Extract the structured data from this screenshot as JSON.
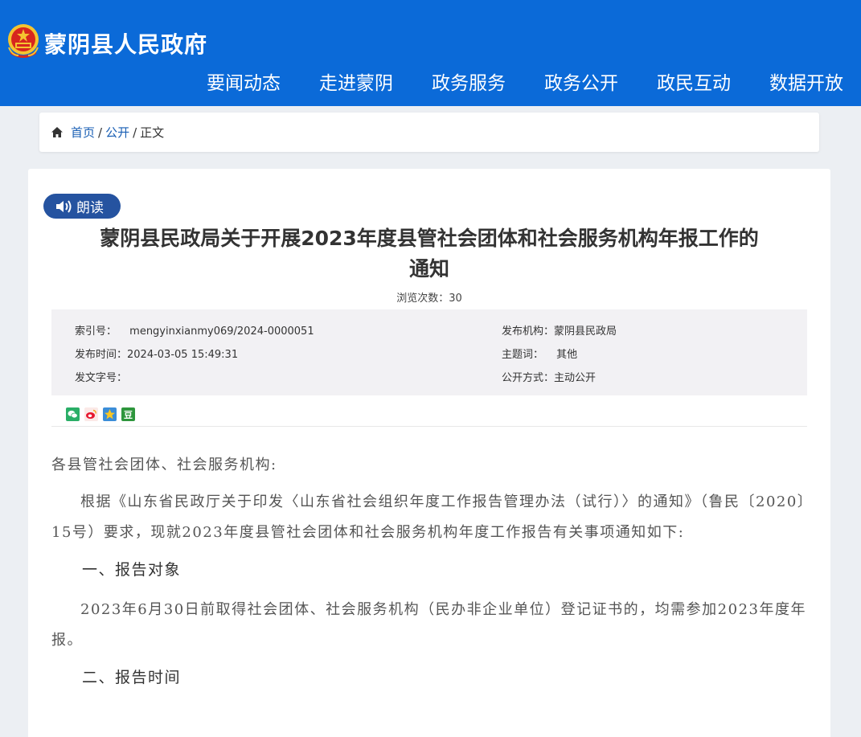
{
  "site": {
    "title": "蒙阴县人民政府"
  },
  "nav": [
    "要闻动态",
    "走进蒙阴",
    "政务服务",
    "政务公开",
    "政民互动",
    "数据开放"
  ],
  "breadcrumb": {
    "home": "首页",
    "section": "公开",
    "current": "正文",
    "sep": "/"
  },
  "read_aloud": "朗读",
  "document": {
    "title": "蒙阴县民政局关于开展2023年度县管社会团体和社会服务机构年报工作的通知",
    "title_line1": "蒙阴县民政局关于开展2023年度县管社会团体和社会服务机构年报工作的",
    "title_line2": "通知",
    "views_label": "浏览次数：",
    "views_count": "30"
  },
  "meta": {
    "index_label": "索引号：",
    "index_value": "mengyinxianmy069/2024-0000051",
    "publisher_label": "发布机构：",
    "publisher_value": "蒙阴县民政局",
    "date_label": "发布时间：",
    "date_value": "2024-03-05 15:49:31",
    "topic_label": "主题词：",
    "topic_value": "其他",
    "docno_label": "发文字号：",
    "docno_value": "",
    "disclosure_label": "公开方式：",
    "disclosure_value": "主动公开"
  },
  "share_icons": [
    "wechat-icon",
    "weibo-icon",
    "qzone-icon",
    "douban-icon"
  ],
  "share_douban_glyph": "豆",
  "article": {
    "salutation": "各县管社会团体、社会服务机构:",
    "para1": "根据《山东省民政厅关于印发〈山东省社会组织年度工作报告管理办法（试行）〉的通知》（鲁民〔2020〕15号）要求，现就2023年度县管社会团体和社会服务机构年度工作报告有关事项通知如下:",
    "heading1": "一、报告对象",
    "para2": "2023年6月30日前取得社会团体、社会服务机构（民办非企业单位）登记证书的，均需参加2023年度年报。",
    "heading2": "二、报告时间"
  },
  "colors": {
    "header_bg": "#0b6ad8",
    "read_btn": "#2553a0",
    "link": "#1a5fb4",
    "meta_bg": "#f2f1f4"
  }
}
